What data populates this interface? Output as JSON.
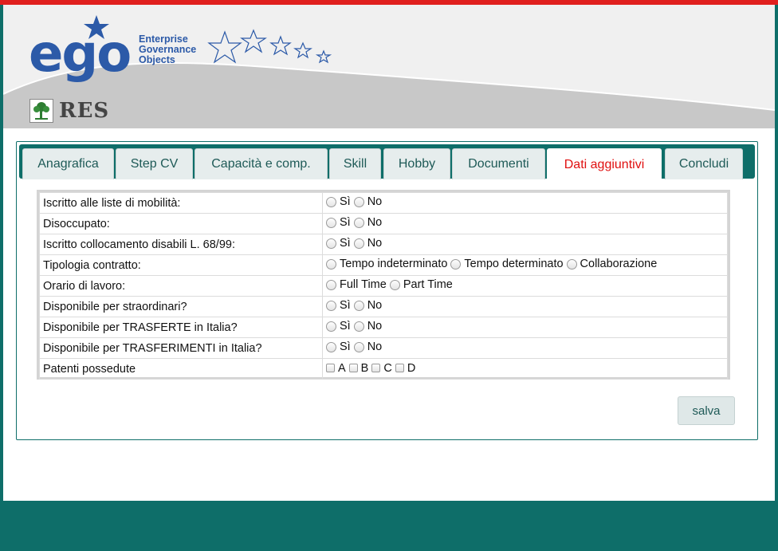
{
  "header": {
    "logo_word": "ego",
    "logo_tagline_1": "Enterprise",
    "logo_tagline_2": "Governance",
    "logo_tagline_3": "Objects",
    "app_name": "RES"
  },
  "tabs": [
    {
      "label": "Anagrafica",
      "active": false
    },
    {
      "label": "Step CV",
      "active": false
    },
    {
      "label": "Capacità e comp.",
      "active": false
    },
    {
      "label": "Skill",
      "active": false
    },
    {
      "label": "Hobby",
      "active": false
    },
    {
      "label": "Documenti",
      "active": false
    },
    {
      "label": "Dati aggiuntivi",
      "active": true
    },
    {
      "label": "Concludi",
      "active": false
    }
  ],
  "form": {
    "rows": [
      {
        "label": "Iscritto alle liste di mobilità:",
        "type": "radio",
        "options": [
          "Sì",
          "No"
        ]
      },
      {
        "label": "Disoccupato:",
        "type": "radio",
        "options": [
          "Sì",
          "No"
        ]
      },
      {
        "label": "Iscritto collocamento disabili L. 68/99:",
        "type": "radio",
        "options": [
          "Sì",
          "No"
        ]
      },
      {
        "label": "Tipologia contratto:",
        "type": "radio",
        "options": [
          "Tempo indeterminato",
          "Tempo determinato",
          "Collaborazione"
        ]
      },
      {
        "label": "Orario di lavoro:",
        "type": "radio",
        "options": [
          "Full Time",
          "Part Time"
        ]
      },
      {
        "label": "Disponibile per straordinari?",
        "type": "radio",
        "options": [
          "Sì",
          "No"
        ]
      },
      {
        "label": "Disponibile per TRASFERTE in Italia?",
        "type": "radio",
        "options": [
          "Sì",
          "No"
        ]
      },
      {
        "label": "Disponibile per TRASFERIMENTI in Italia?",
        "type": "radio",
        "options": [
          "Sì",
          "No"
        ]
      },
      {
        "label": "Patenti possedute",
        "type": "checkbox",
        "options": [
          "A",
          "B",
          "C",
          "D"
        ]
      }
    ]
  },
  "actions": {
    "save_label": "salva"
  },
  "colors": {
    "teal": "#0e6e69",
    "red_bar": "#e0201e",
    "active_tab_text": "#e01010",
    "logo_blue": "#2c5aa8"
  }
}
